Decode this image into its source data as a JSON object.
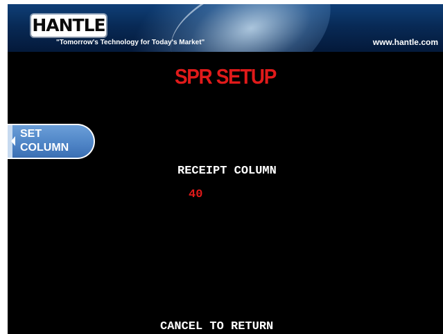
{
  "header": {
    "logo_text": "HANTLE",
    "tagline": "\"Tomorrow's Technology for Today's Market\"",
    "website": "www.hantle.com"
  },
  "screen": {
    "title": "SPR SETUP",
    "title_color": "#e01a1a",
    "background_color": "#000000"
  },
  "side_buttons": {
    "set_column": {
      "label": "SET\nCOLUMN",
      "color": "#4d83c5"
    }
  },
  "content": {
    "receipt_column_label": "RECEIPT COLUMN",
    "receipt_column_value": "40",
    "value_color": "#e01a1a"
  },
  "footer": {
    "cancel_prompt": "CANCEL TO RETURN"
  }
}
